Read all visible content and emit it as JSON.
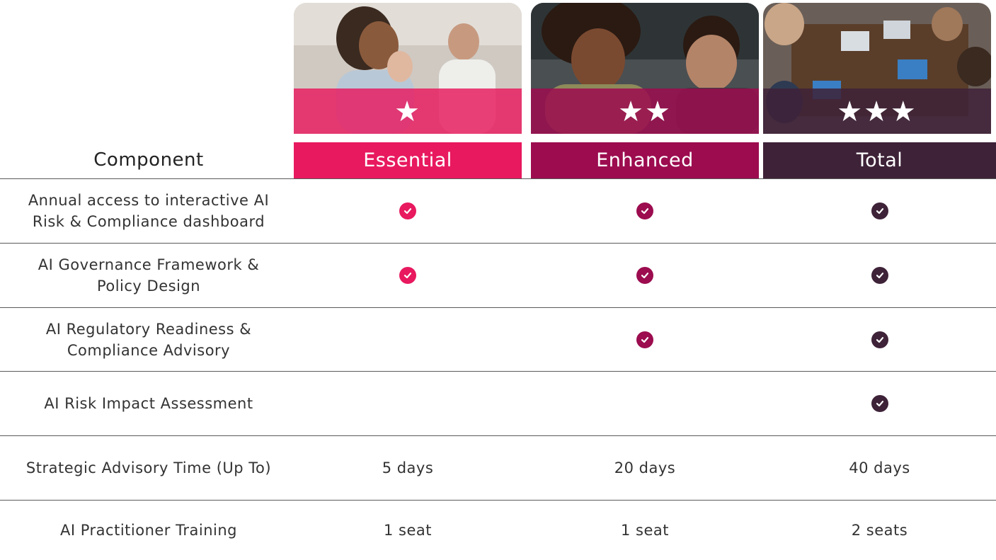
{
  "colors": {
    "essential": "#e8195e",
    "enhanced": "#9c0c4f",
    "total": "#3e2238",
    "divider": "#5a5a5a"
  },
  "header": {
    "component_label": "Component"
  },
  "tiers": [
    {
      "name": "Essential",
      "stars": "★",
      "star_count": 1,
      "image": "people-meeting-photo"
    },
    {
      "name": "Enhanced",
      "stars": "★★",
      "star_count": 2,
      "image": "two-people-at-desk-photo"
    },
    {
      "name": "Total",
      "stars": "★★★",
      "star_count": 3,
      "image": "overhead-team-table-photo"
    }
  ],
  "rows": [
    {
      "label": "Annual access to interactive AI Risk & Compliance dashboard",
      "essential": "check",
      "enhanced": "check",
      "total": "check"
    },
    {
      "label": "AI Governance Framework & Policy Design",
      "essential": "check",
      "enhanced": "check",
      "total": "check"
    },
    {
      "label": "AI Regulatory Readiness & Compliance Advisory",
      "essential": "",
      "enhanced": "check",
      "total": "check"
    },
    {
      "label": "AI Risk Impact Assessment",
      "essential": "",
      "enhanced": "",
      "total": "check"
    },
    {
      "label": "Strategic Advisory Time (Up To)",
      "essential": "5 days",
      "enhanced": "20 days",
      "total": "40 days"
    },
    {
      "label": "AI Practitioner Training",
      "essential": "1 seat",
      "enhanced": "1 seat",
      "total": "2 seats"
    }
  ]
}
